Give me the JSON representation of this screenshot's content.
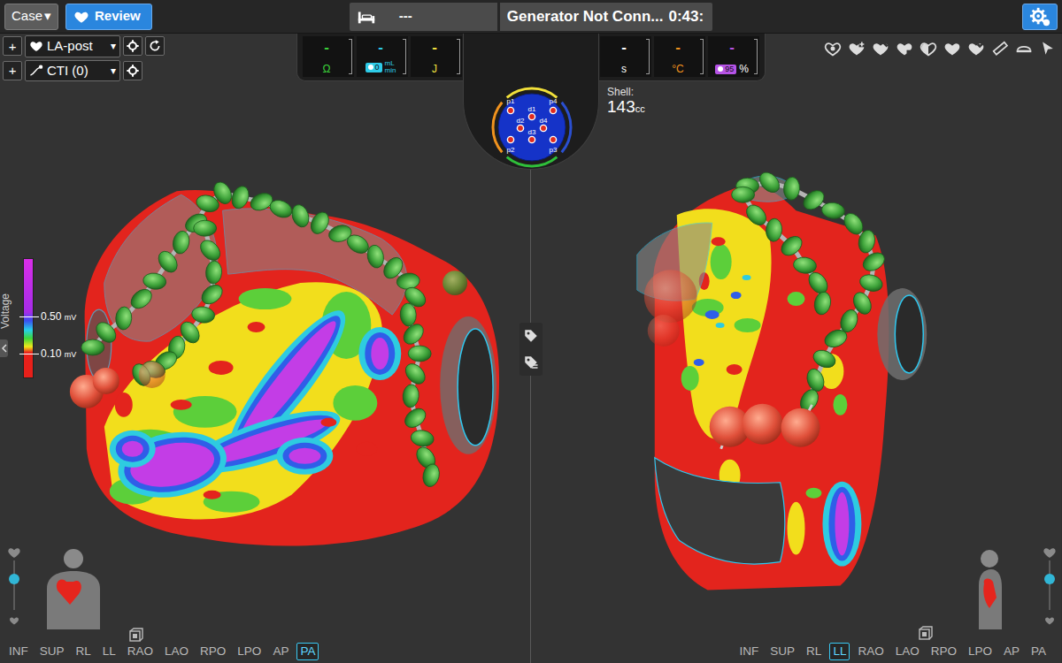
{
  "topbar": {
    "case_button": {
      "label": "Case",
      "caret": "▾"
    },
    "review_button": {
      "label": "Review",
      "selected": true
    },
    "bed_value": "---",
    "status": "Generator Not Conn...",
    "timer": "0:43:"
  },
  "map_selectors": [
    {
      "add": "+",
      "label": "LA-post",
      "caret": "▾",
      "kind": "map"
    },
    {
      "add": "+",
      "label": "CTI (0)",
      "caret": "▾",
      "kind": "lesion"
    }
  ],
  "readouts": [
    {
      "value": "-",
      "unit": "Ω",
      "color": "#3ad13a"
    },
    {
      "value": "-",
      "badge": "0",
      "unit": "mL",
      "unit2": "min",
      "color": "#2ecbe8"
    },
    {
      "value": "-",
      "unit": "J",
      "color": "#f0e040"
    },
    {
      "value": "-",
      "unit": "s",
      "color": "#ffffff"
    },
    {
      "value": "-",
      "unit": "°C",
      "color": "#f0921e"
    },
    {
      "value": "-",
      "badge": "95",
      "unit": "%",
      "color": "#b653e6"
    }
  ],
  "catheter": {
    "electrodes": [
      "p1",
      "p4",
      "d1",
      "d2",
      "d4",
      "d3",
      "p2",
      "p3"
    ]
  },
  "shell": {
    "label": "Shell:",
    "value": "143",
    "unit": "cc"
  },
  "legend": {
    "title": "Voltage",
    "ticks": [
      {
        "value": "0.50",
        "unit": "mV"
      },
      {
        "value": "0.10",
        "unit": "mV"
      }
    ]
  },
  "views": {
    "left": [
      {
        "label": "INF",
        "selected": false
      },
      {
        "label": "SUP",
        "selected": false
      },
      {
        "label": "RL",
        "selected": false
      },
      {
        "label": "LL",
        "selected": false
      },
      {
        "label": "RAO",
        "selected": false
      },
      {
        "label": "LAO",
        "selected": false
      },
      {
        "label": "RPO",
        "selected": false
      },
      {
        "label": "LPO",
        "selected": false
      },
      {
        "label": "AP",
        "selected": false
      },
      {
        "label": "PA",
        "selected": true
      }
    ],
    "right": [
      {
        "label": "INF",
        "selected": false
      },
      {
        "label": "SUP",
        "selected": false
      },
      {
        "label": "RL",
        "selected": false
      },
      {
        "label": "LL",
        "selected": true
      },
      {
        "label": "RAO",
        "selected": false
      },
      {
        "label": "LAO",
        "selected": false
      },
      {
        "label": "RPO",
        "selected": false
      },
      {
        "label": "LPO",
        "selected": false
      },
      {
        "label": "AP",
        "selected": false
      },
      {
        "label": "PA",
        "selected": false
      }
    ]
  },
  "sliders": {
    "left": {
      "level": 0.62
    },
    "right": {
      "level": 0.62
    }
  }
}
